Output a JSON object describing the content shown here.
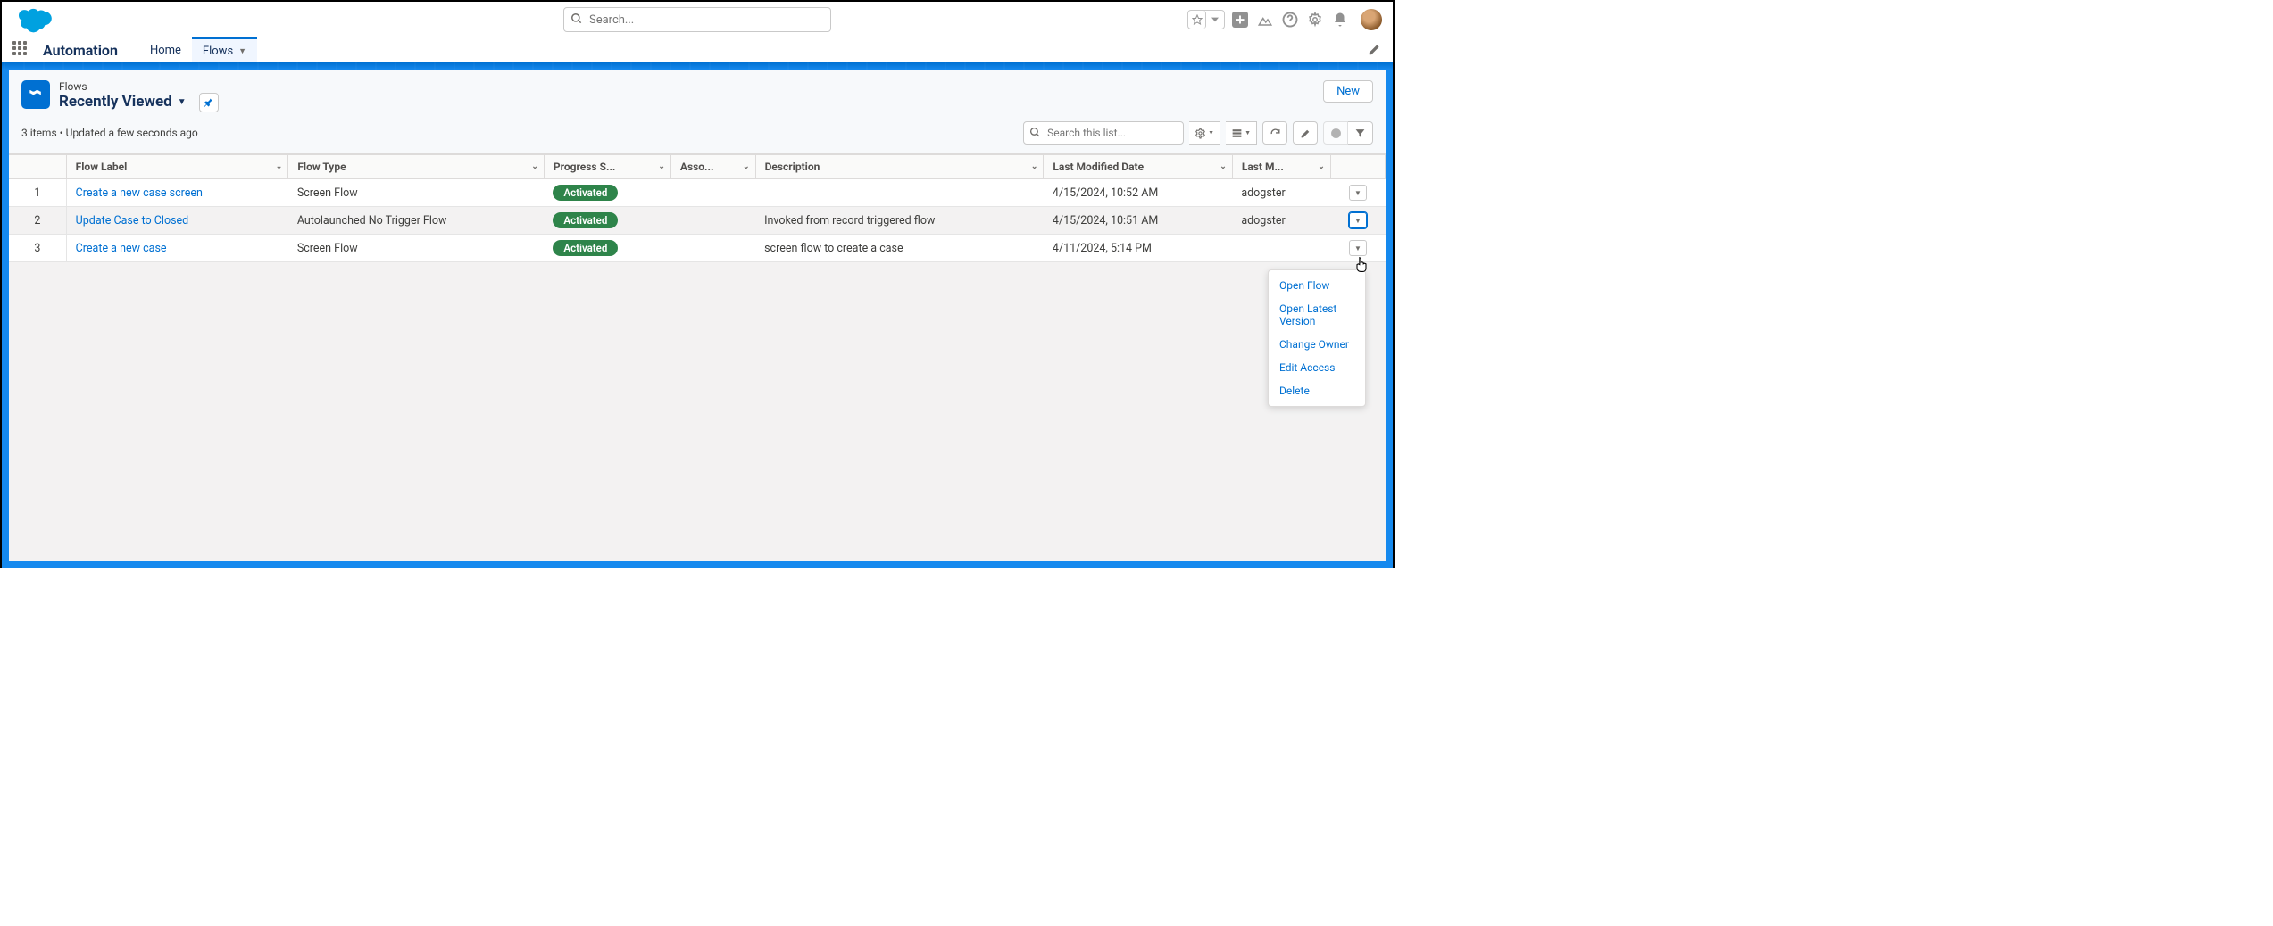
{
  "header": {
    "search_placeholder": "Search...",
    "app_name": "Automation"
  },
  "nav": {
    "items": [
      {
        "label": "Home",
        "active": false
      },
      {
        "label": "Flows",
        "active": true
      }
    ]
  },
  "list_header": {
    "object": "Flows",
    "list_name": "Recently Viewed",
    "status": "3 items • Updated a few seconds ago",
    "search_placeholder": "Search this list...",
    "new_button": "New"
  },
  "columns": {
    "num": "",
    "label": "Flow Label",
    "type": "Flow Type",
    "progress": "Progress S...",
    "asso": "Asso...",
    "desc": "Description",
    "date": "Last Modified Date",
    "mod": "Last M..."
  },
  "rows": [
    {
      "num": "1",
      "label": "Create a new case screen",
      "type": "Screen Flow",
      "status": "Activated",
      "asso": "",
      "desc": "",
      "date": "4/15/2024, 10:52 AM",
      "mod": "adogster"
    },
    {
      "num": "2",
      "label": "Update Case to Closed",
      "type": "Autolaunched No Trigger Flow",
      "status": "Activated",
      "asso": "",
      "desc": "Invoked from record triggered flow",
      "date": "4/15/2024, 10:51 AM",
      "mod": "adogster"
    },
    {
      "num": "3",
      "label": "Create a new case",
      "type": "Screen Flow",
      "status": "Activated",
      "asso": "",
      "desc": "screen flow to create a case",
      "date": "4/11/2024, 5:14 PM",
      "mod": ""
    }
  ],
  "menu": {
    "items": [
      "Open Flow",
      "Open Latest Version",
      "Change Owner",
      "Edit Access",
      "Delete"
    ]
  }
}
